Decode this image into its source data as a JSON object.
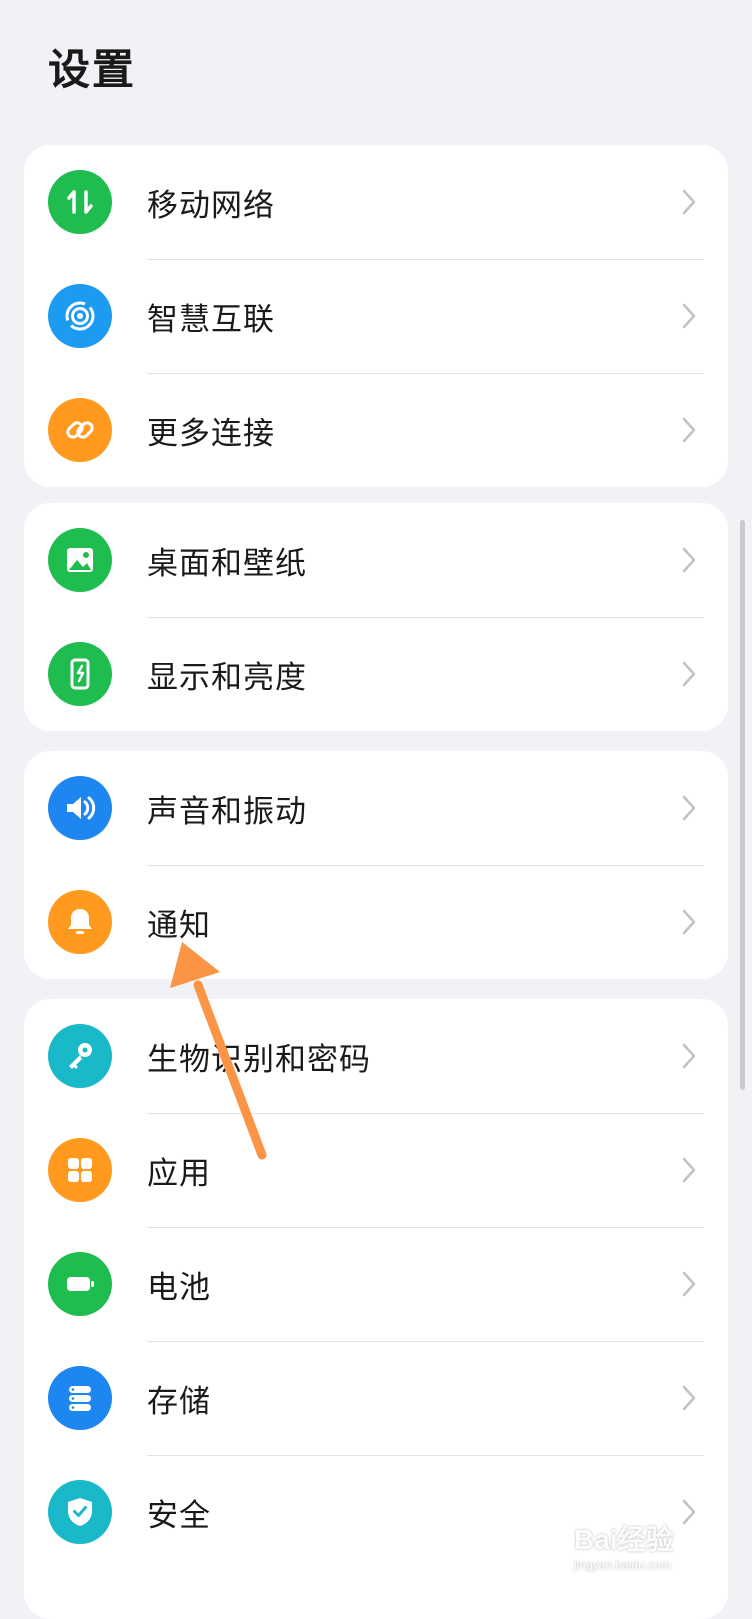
{
  "page": {
    "title": "设置"
  },
  "groups": [
    {
      "items": [
        {
          "label": "移动网络",
          "icon": "mobile-data-icon",
          "color": "#1fbd4f"
        },
        {
          "label": "智慧互联",
          "icon": "smart-connect-icon",
          "color": "#1d9bf0"
        },
        {
          "label": "更多连接",
          "icon": "link-icon",
          "color": "#ff9a1f"
        }
      ]
    },
    {
      "items": [
        {
          "label": "桌面和壁纸",
          "icon": "wallpaper-icon",
          "color": "#1fbd4f"
        },
        {
          "label": "显示和亮度",
          "icon": "display-brightness-icon",
          "color": "#1fbd4f"
        }
      ]
    },
    {
      "items": [
        {
          "label": "声音和振动",
          "icon": "speaker-icon",
          "color": "#1d86f0"
        },
        {
          "label": "通知",
          "icon": "bell-icon",
          "color": "#ff9a1f"
        }
      ]
    },
    {
      "items": [
        {
          "label": "生物识别和密码",
          "icon": "key-icon",
          "color": "#19b9c9"
        },
        {
          "label": "应用",
          "icon": "apps-grid-icon",
          "color": "#ff9a1f"
        },
        {
          "label": "电池",
          "icon": "battery-icon",
          "color": "#1fbd4f"
        },
        {
          "label": "存储",
          "icon": "storage-icon",
          "color": "#1d86f0"
        },
        {
          "label": "安全",
          "icon": "shield-check-icon",
          "color": "#19b9c9"
        }
      ]
    }
  ],
  "annotation": {
    "arrow_color": "#fb9445"
  },
  "watermark": {
    "main": "Bai经验",
    "sub": "jingyan.baidu.com"
  }
}
